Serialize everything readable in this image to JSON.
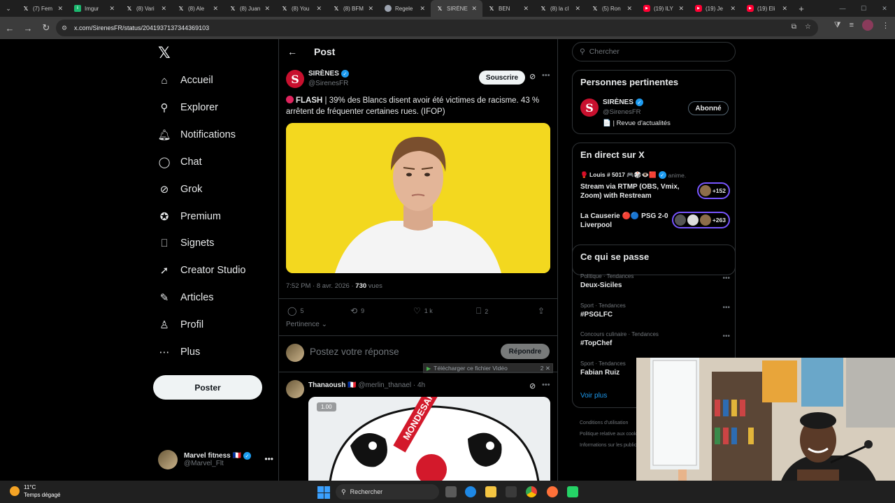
{
  "browser": {
    "tabs": [
      {
        "icon": "x",
        "title": "(7) Fem"
      },
      {
        "icon": "img",
        "title": "Imgur"
      },
      {
        "icon": "x",
        "title": "(8) Vari"
      },
      {
        "icon": "x",
        "title": "(8) Ale"
      },
      {
        "icon": "x",
        "title": "(8) Juan"
      },
      {
        "icon": "x",
        "title": "(8) You"
      },
      {
        "icon": "x",
        "title": "(8) BFM"
      },
      {
        "icon": "rg",
        "title": "Regele"
      },
      {
        "icon": "x",
        "title": "SIRÈNE",
        "active": true
      },
      {
        "icon": "x",
        "title": "BEN"
      },
      {
        "icon": "x",
        "title": "(8) la cl"
      },
      {
        "icon": "x",
        "title": "(5) Ron"
      },
      {
        "icon": "yt",
        "title": "(19) ILY"
      },
      {
        "icon": "yt",
        "title": "(19) Je"
      },
      {
        "icon": "yt",
        "title": "(19) Eli"
      }
    ],
    "url": "x.com/SirenesFR/status/2041937137344369103"
  },
  "sidebar": {
    "logo": "𝕏",
    "items": [
      {
        "icon": "⌂",
        "label": "Accueil"
      },
      {
        "icon": "⚲",
        "label": "Explorer"
      },
      {
        "icon": "🔔︎",
        "label": "Notifications"
      },
      {
        "icon": "◯",
        "label": "Chat"
      },
      {
        "icon": "⊘",
        "label": "Grok"
      },
      {
        "icon": "✪",
        "label": "Premium"
      },
      {
        "icon": "⎕",
        "label": "Signets"
      },
      {
        "icon": "➚",
        "label": "Creator Studio"
      },
      {
        "icon": "✎",
        "label": "Articles"
      },
      {
        "icon": "♙",
        "label": "Profil"
      },
      {
        "icon": "⋯",
        "label": "Plus"
      }
    ],
    "post_button": "Poster",
    "account": {
      "name": "Marvel fitness 🇫🇷",
      "handle": "@Marvel_Flt"
    }
  },
  "main": {
    "header_title": "Post",
    "tweet": {
      "author_name": "SIRÈNES",
      "author_handle": "@SirenesFR",
      "subscribe_label": "Souscrire",
      "flash": "FLASH",
      "text": "| 39% des Blancs disent avoir été victimes de racisme. 43 % arrêtent de fréquenter certaines rues. (IFOP)",
      "time": "7:52 PM · 8 avr. 2026 · ",
      "views_count": "730",
      "views_label": " vues",
      "replies": "5",
      "reposts": "9",
      "likes": "1 k",
      "bookmarks": "2"
    },
    "sort_label": "Pertinence ⌄",
    "reply_placeholder": "Postez votre réponse",
    "reply_button": "Répondre",
    "download_video": "Télécharger ce fichier Vidéo",
    "download_hint": "2  ✕",
    "reply": {
      "name": "Thanaoush",
      "meta": " 🇫🇷 @merlin_thanael · 4h",
      "speed": "1.00",
      "media_text": "MONDESAPTI"
    }
  },
  "right": {
    "search_placeholder": "Chercher",
    "pertinent": {
      "title": "Personnes pertinentes",
      "name": "SIRÈNES",
      "handle": "@SirenesFR",
      "bio": "📄 | Revue d'actualités",
      "follow_label": "Abonné"
    },
    "live": {
      "title": "En direct sur X",
      "items": [
        {
          "host": "🥊 Louis # 5017 🎮🎲👁️🟥",
          "host_suffix": " anime.",
          "title": "Stream via RTMP (OBS, Vmix, Zoom) with Restream",
          "count": "+152"
        },
        {
          "host": "",
          "host_suffix": "",
          "title": "La Causerie 🔴🔵 PSG 2-0 Liverpool",
          "count": "+263"
        }
      ]
    },
    "trends": {
      "title": "Ce qui se passe",
      "items": [
        {
          "category": "Politique · Tendances",
          "name": "Deux-Siciles"
        },
        {
          "category": "Sport · Tendances",
          "name": "#PSGLFC"
        },
        {
          "category": "Concours culinaire · Tendances",
          "name": "#TopChef"
        },
        {
          "category": "Sport · Tendances",
          "name": "Fabian Ruiz"
        }
      ],
      "see_more": "Voir plus"
    },
    "footer": [
      "Conditions d'utilisation",
      "Politique relative aux cookies",
      "Informations sur les publicités"
    ]
  },
  "taskbar": {
    "temperature": "11°C",
    "weather": "Temps dégagé",
    "search": "Rechercher"
  }
}
